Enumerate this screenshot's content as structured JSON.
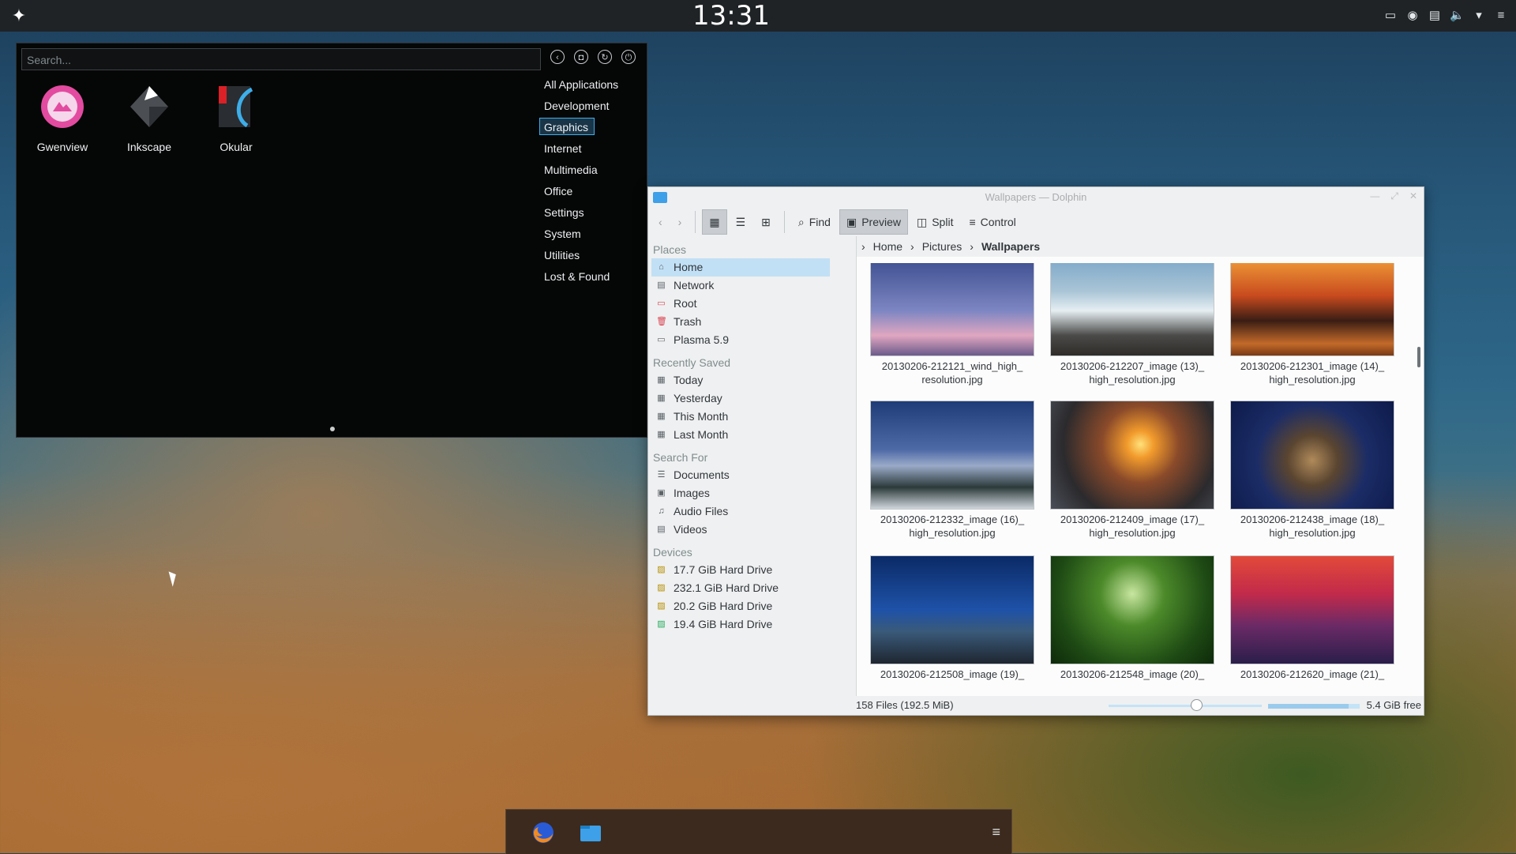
{
  "panel": {
    "clock": "13:31",
    "tray_icons": [
      "screen-icon",
      "device-icon",
      "clipboard-icon",
      "volume-icon",
      "chevron-down-icon",
      "menu-icon"
    ]
  },
  "launcher": {
    "search_placeholder": "Search...",
    "apps": [
      {
        "label": "Gwenview",
        "icon": "gwenview-icon"
      },
      {
        "label": "Inkscape",
        "icon": "inkscape-icon"
      },
      {
        "label": "Okular",
        "icon": "okular-icon"
      }
    ],
    "categories": [
      "All Applications",
      "Development",
      "Graphics",
      "Internet",
      "Multimedia",
      "Office",
      "Settings",
      "System",
      "Utilities",
      "Lost & Found"
    ],
    "active_category": "Graphics"
  },
  "dolphin": {
    "title": "Wallpapers — Dolphin",
    "toolbar": {
      "find": "Find",
      "preview": "Preview",
      "split": "Split",
      "control": "Control"
    },
    "places": {
      "places_header": "Places",
      "places_items": [
        "Home",
        "Network",
        "Root",
        "Trash",
        "Plasma 5.9"
      ],
      "recent_header": "Recently Saved",
      "recent_items": [
        "Today",
        "Yesterday",
        "This Month",
        "Last Month"
      ],
      "search_header": "Search For",
      "search_items": [
        "Documents",
        "Images",
        "Audio Files",
        "Videos"
      ],
      "devices_header": "Devices",
      "devices_items": [
        "17.7 GiB Hard Drive",
        "232.1 GiB Hard Drive",
        "20.2 GiB Hard Drive",
        "19.4 GiB Hard Drive"
      ]
    },
    "breadcrumb": [
      "Home",
      "Pictures",
      "Wallpapers"
    ],
    "files": [
      {
        "line1": "20130206-212121_wind_high_",
        "line2": "resolution.jpg"
      },
      {
        "line1": "20130206-212207_image (13)_",
        "line2": "high_resolution.jpg"
      },
      {
        "line1": "20130206-212301_image (14)_",
        "line2": "high_resolution.jpg"
      },
      {
        "line1": "20130206-212332_image (16)_",
        "line2": "high_resolution.jpg"
      },
      {
        "line1": "20130206-212409_image (17)_",
        "line2": "high_resolution.jpg"
      },
      {
        "line1": "20130206-212438_image (18)_",
        "line2": "high_resolution.jpg"
      },
      {
        "line1": "20130206-212508_image (19)_",
        "line2": ""
      },
      {
        "line1": "20130206-212548_image (20)_",
        "line2": ""
      },
      {
        "line1": "20130206-212620_image (21)_",
        "line2": ""
      }
    ],
    "status": {
      "files": "158 Files (192.5 MiB)",
      "free": "5.4 GiB free",
      "zoom_level": 0.57,
      "capacity_used": 0.88
    }
  },
  "taskbar": {
    "apps": [
      "firefox-icon",
      "dolphin-icon"
    ]
  }
}
